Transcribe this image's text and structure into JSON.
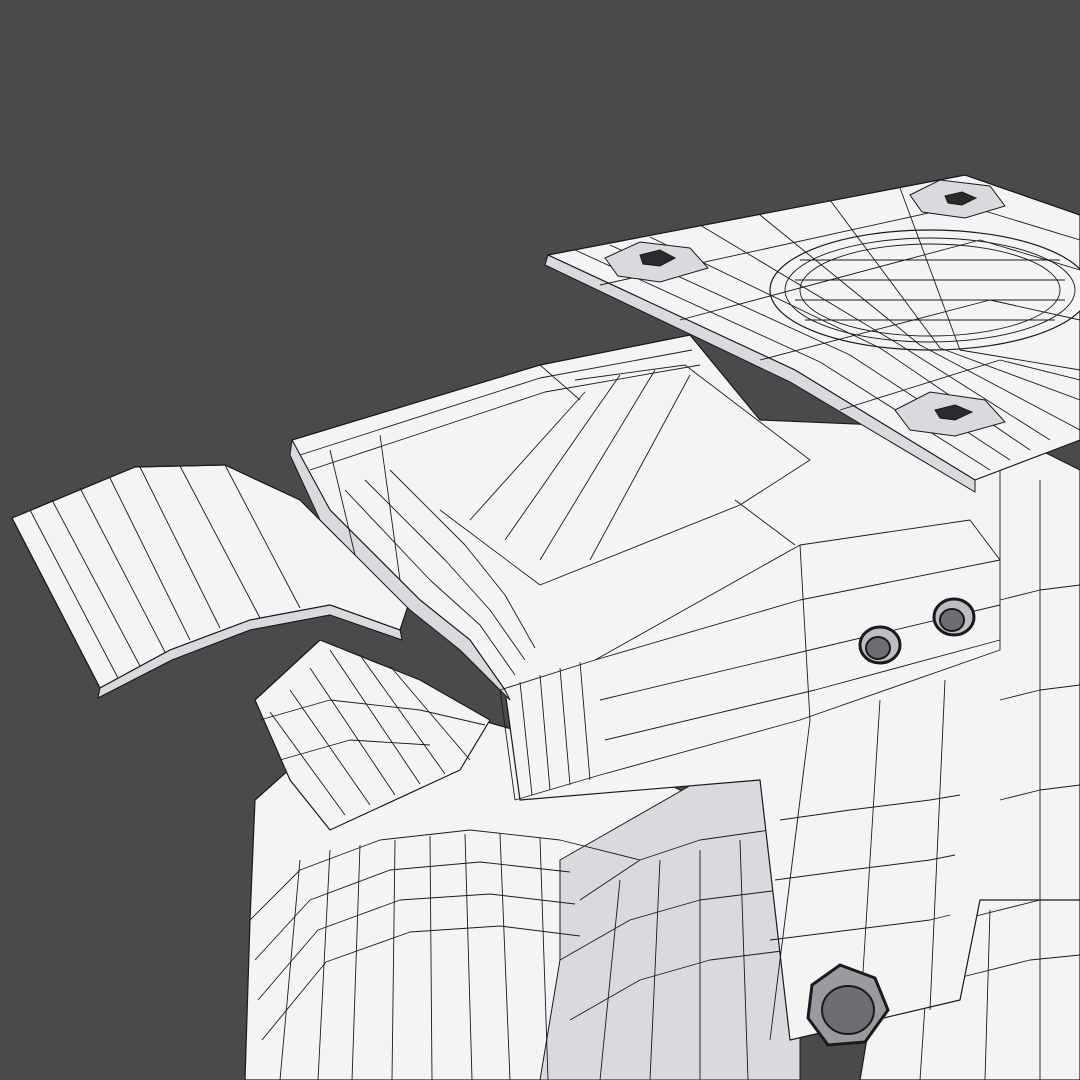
{
  "scene": {
    "background_color": "#4a4a4a",
    "mesh_fill_color": "#f4f4f6",
    "mesh_shade_color": "#d9d9de",
    "wire_color": "#1a1a1a",
    "view_mode": "wireframe-on-shaded",
    "subject": "caster-wheel-model"
  }
}
